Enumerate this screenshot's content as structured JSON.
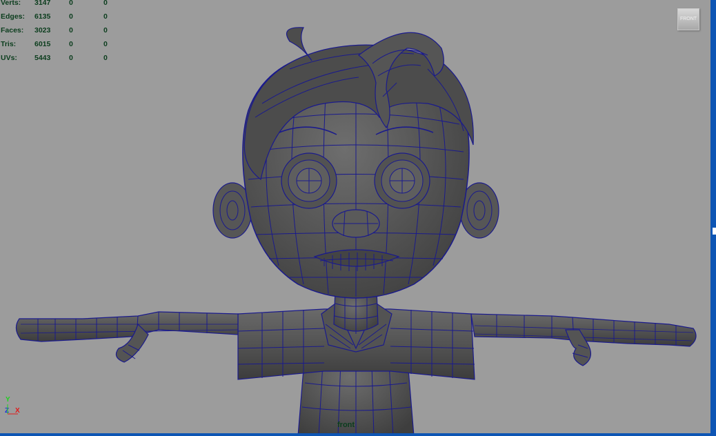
{
  "hud": {
    "rows": [
      {
        "label": "Verts:",
        "v1": "3147",
        "v2": "0",
        "v3": "0"
      },
      {
        "label": "Edges:",
        "v1": "6135",
        "v2": "0",
        "v3": "0"
      },
      {
        "label": "Faces:",
        "v1": "3023",
        "v2": "0",
        "v3": "0"
      },
      {
        "label": "Tris:",
        "v1": "6015",
        "v2": "0",
        "v3": "0"
      },
      {
        "label": "UVs:",
        "v1": "5443",
        "v2": "0",
        "v3": "0"
      }
    ]
  },
  "viewcube": {
    "label": "FRONT"
  },
  "camera_label": "front",
  "axes": {
    "y": "Y",
    "z": "Z",
    "x": "X",
    "y_color": "#1fd01f",
    "z_color": "#1a2fe0",
    "x_color": "#e01a1a"
  },
  "colors": {
    "viewport_bg": "#9c9c9c",
    "wire": "#1a1a8c",
    "mesh": "#5a5a5a",
    "frame": "#0d55b4"
  }
}
